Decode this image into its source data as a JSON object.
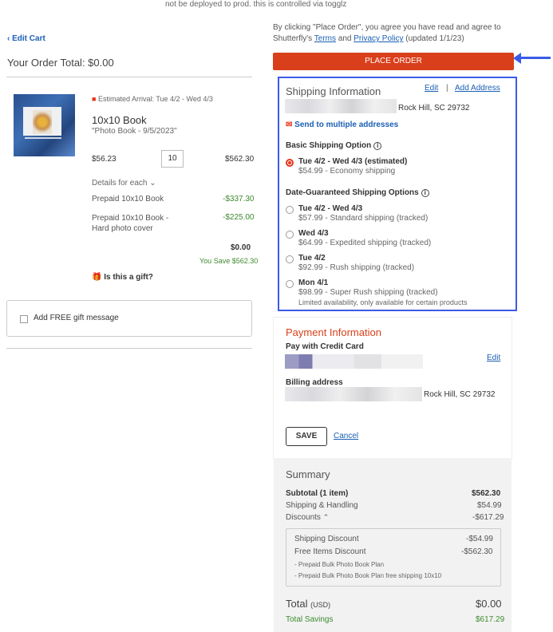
{
  "banner": "not be deployed to prod. this is controlled via togglz",
  "cart": {
    "edit_cart": "Edit Cart",
    "order_total": "Your Order Total: $0.00",
    "estimated_arrival": "Estimated Arrival: Tue 4/2 - Wed 4/3",
    "product_title": "10x10 Book",
    "product_sub": "\"Photo Book - 9/5/2023\"",
    "unit_price": "$56.23",
    "quantity": "10",
    "line_total": "$562.30",
    "details_label": "Details for each",
    "prepaid1_label": "Prepaid 10x10 Book",
    "prepaid1_value": "-$337.30",
    "prepaid2_label": "Prepaid 10x10 Book - Hard photo cover",
    "prepaid2_value": "-$225.00",
    "item_total": "$0.00",
    "you_save": "You Save $562.30",
    "gift_label": "Is this a gift?",
    "gift_message": "Add FREE gift message"
  },
  "agreement": {
    "text1": "By clicking \"Place Order\", you agree you have read and agree to Shutterfly's",
    "terms": "Terms",
    "and": "and",
    "privacy": "Privacy Policy",
    "updated": "(updated 1/1/23)"
  },
  "place_order": "PLACE ORDER",
  "shipping": {
    "title": "Shipping Information",
    "edit": "Edit",
    "sep": "|",
    "add_address": "Add Address",
    "city": "Rock Hill, SC 29732",
    "multiple": "Send to multiple addresses",
    "basic_heading": "Basic Shipping Option",
    "basic_option": {
      "date": "Tue 4/2 - Wed 4/3 (estimated)",
      "desc": "$54.99 - Economy shipping"
    },
    "guaranteed_heading": "Date-Guaranteed Shipping Options",
    "options": [
      {
        "date": "Tue 4/2 - Wed 4/3",
        "desc": "$57.99 - Standard shipping (tracked)"
      },
      {
        "date": "Wed 4/3",
        "desc": "$64.99 - Expedited shipping (tracked)"
      },
      {
        "date": "Tue 4/2",
        "desc": "$92.99 - Rush shipping (tracked)"
      },
      {
        "date": "Mon 4/1",
        "desc": "$98.99 - Super Rush shipping (tracked)",
        "note": "Limited availability, only available for certain products"
      }
    ]
  },
  "payment": {
    "title": "Payment Information",
    "pay_with": "Pay with Credit Card",
    "edit": "Edit",
    "billing_label": "Billing address",
    "billing_city": "Rock Hill, SC 29732",
    "save": "SAVE",
    "cancel": "Cancel"
  },
  "summary": {
    "title": "Summary",
    "subtotal_label": "Subtotal (1 item)",
    "subtotal_value": "$562.30",
    "shipping_label": "Shipping & Handling",
    "shipping_value": "$54.99",
    "discounts_label": "Discounts",
    "discounts_value": "-$617.29",
    "ship_discount_label": "Shipping Discount",
    "ship_discount_value": "-$54.99",
    "free_items_label": "Free Items Discount",
    "free_items_value": "-$562.30",
    "plan1": "- Prepaid Bulk Photo Book Plan",
    "plan2": "- Prepaid Bulk Photo Book Plan free shipping 10x10",
    "total_label": "Total",
    "total_currency": "(USD)",
    "total_value": "$0.00",
    "savings_label": "Total Savings",
    "savings_value": "$617.29"
  },
  "colors": {
    "accent_red": "#d93f1b",
    "highlight_blue": "#3b5be8",
    "link_blue": "#1a5fb4",
    "green": "#3c8a2e"
  }
}
